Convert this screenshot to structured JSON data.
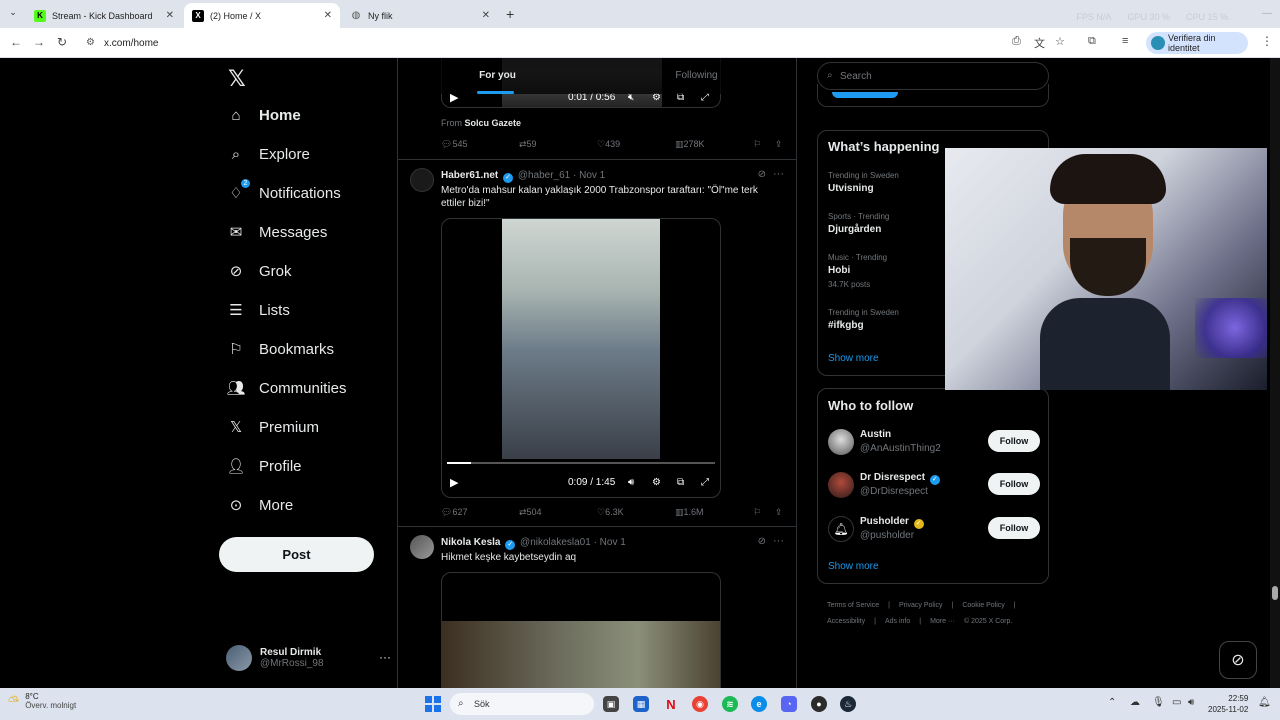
{
  "browser": {
    "tabs": [
      {
        "title": "Stream - Kick Dashboard",
        "icon": "kick-icon"
      },
      {
        "title": "(2) Home / X",
        "icon": "x-icon"
      },
      {
        "title": "Ny flik",
        "icon": "globe-icon"
      }
    ],
    "url": "x.com/home",
    "profile_label": "Verifiera din identitet",
    "stats": {
      "fps": "FPS  N/A",
      "gpu": "GPU  30 %",
      "cpu": "CPU  15 %"
    }
  },
  "nav": {
    "items": [
      {
        "label": "Home",
        "icon": "home-icon"
      },
      {
        "label": "Explore",
        "icon": "search-icon"
      },
      {
        "label": "Notifications",
        "icon": "bell-icon",
        "badge": "2"
      },
      {
        "label": "Messages",
        "icon": "envelope-icon"
      },
      {
        "label": "Grok",
        "icon": "grok-icon"
      },
      {
        "label": "Lists",
        "icon": "list-icon"
      },
      {
        "label": "Bookmarks",
        "icon": "bookmark-icon"
      },
      {
        "label": "Communities",
        "icon": "people-icon"
      },
      {
        "label": "Premium",
        "icon": "x-icon"
      },
      {
        "label": "Profile",
        "icon": "person-icon"
      },
      {
        "label": "More",
        "icon": "more-circle-icon"
      }
    ],
    "post_label": "Post",
    "account": {
      "name": "Resul Dirmik",
      "handle": "@MrRossi_98"
    }
  },
  "timeline": {
    "tabs": [
      "For you",
      "Following"
    ],
    "tweet0": {
      "video_time": "0:01 / 0:56",
      "from_prefix": "From",
      "from_source": "Solcu Gazete",
      "replies": "545",
      "reposts": "59",
      "likes": "439",
      "views": "278K"
    },
    "tweet1": {
      "name": "Haber61.net",
      "handle": "@haber_61",
      "date": "· Nov 1",
      "text": "Metro'da mahsur kalan yaklaşık 2000 Trabzonspor taraftarı: \"Öl\"me terk ettiler bizi!\"",
      "video_time": "0:09 / 1:45",
      "video_progress": 0.09,
      "replies": "627",
      "reposts": "504",
      "likes": "6.3K",
      "views": "1.6M"
    },
    "tweet2": {
      "name": "Nikola Kesla",
      "handle": "@nikolakesla01",
      "date": "· Nov 1",
      "text": "Hikmet keşke kaybetseydin aq"
    }
  },
  "sidebar": {
    "search_placeholder": "Search",
    "whats_happening": "What’s happening",
    "trends": [
      {
        "meta": "Trending in Sweden",
        "name": "Utvisning",
        "posts": ""
      },
      {
        "meta": "Sports · Trending",
        "name": "Djurgården",
        "posts": ""
      },
      {
        "meta": "Music · Trending",
        "name": "Hobi",
        "posts": "34.7K posts"
      },
      {
        "meta": "Trending in Sweden",
        "name": "#ifkgbg",
        "posts": ""
      }
    ],
    "show_more": "Show more",
    "who_to_follow": "Who to follow",
    "follow_label": "Follow",
    "suggestions": [
      {
        "name": "Austin",
        "handle": "@AnAustinThing2",
        "verified": ""
      },
      {
        "name": "Dr Disrespect",
        "handle": "@DrDisrespect",
        "verified": "blue"
      },
      {
        "name": "Pusholder",
        "handle": "@pusholder",
        "verified": "gold"
      }
    ],
    "footer": [
      "Terms of Service",
      "|",
      "Privacy Policy",
      "|",
      "Cookie Policy",
      "|",
      "Accessibility",
      "|",
      "Ads info",
      "|",
      "More ···",
      "© 2025 X Corp."
    ]
  },
  "taskbar": {
    "temp": "8°C",
    "weather": "Överv. molnigt",
    "search_placeholder": "Sök",
    "time": "22:59",
    "date": "2025-11-02"
  }
}
